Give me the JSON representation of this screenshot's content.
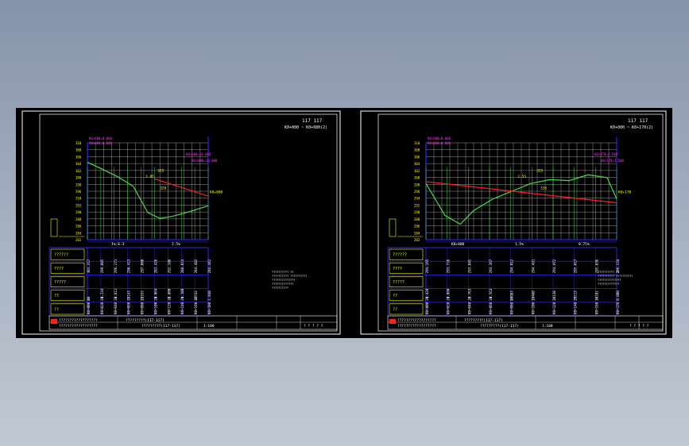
{
  "colors": {
    "background": "#000000",
    "frame": "#ffffff",
    "grid": "#d8d8d8",
    "axis": "#3030ff",
    "ground_line": "#44dd44",
    "design_line": "#ff2020",
    "label": "#ffff00",
    "note": "#ff33ff",
    "table_text": "#ffffff"
  },
  "sheets": [
    {
      "id": "left",
      "header": {
        "title": "117  117",
        "subtitle": "K0+000 ~ K0+080(2)"
      },
      "row_labels": [
        "??????",
        "????",
        "?????",
        "??",
        "??"
      ],
      "axis_ticks": [
        "310",
        "308",
        "306",
        "304",
        "302",
        "300",
        "298",
        "296",
        "294",
        "292",
        "290",
        "288",
        "286",
        "284",
        "282"
      ],
      "section_marks": [
        "1%:0.3",
        "2.5%"
      ],
      "annotations": {
        "left_top": "K0+000=0.000",
        "right_top": "K0+080=18.000",
        "end_label": "K0+080",
        "mid_labels": [
          "2.85",
          "325",
          "326"
        ]
      },
      "table_cols": [
        [
          "303.317",
          "0",
          "20",
          "K0+000"
        ],
        [
          "299.085",
          "-4.234",
          "20",
          "K0+020"
        ],
        [
          "296.271",
          "-2.811",
          "20",
          "K0+040"
        ],
        [
          "298.413",
          "2.143",
          "20",
          "K0+060"
        ],
        [
          "297.080",
          "1.333",
          "20",
          "K0+080"
        ],
        [
          "283.426",
          "-4.064",
          "20",
          "K0+100"
        ],
        [
          "292.188",
          "-2.800",
          "20",
          "K0+120"
        ],
        [
          "288.014",
          "-0.100",
          "20",
          "K0+140"
        ],
        [
          "284.482",
          "3.532",
          "20",
          "K0+160"
        ],
        [
          "284.482",
          "1.848",
          "",
          "K0+180"
        ]
      ],
      "legend": [
        "?????????? ??",
        "?????????? ??????????",
        "??????????????",
        "?????????????",
        "??????????"
      ],
      "title_block": {
        "company": "??????????????????",
        "drawing": "?????????(117-117)",
        "scale": "1:100",
        "sheet": "? ? ? ? ?"
      }
    },
    {
      "id": "right",
      "header": {
        "title": "117  117",
        "subtitle": "K0+000 ~ K0+170(2)"
      },
      "row_labels": [
        "??????",
        "????",
        "?????",
        "??",
        "??"
      ],
      "axis_ticks": [
        "310",
        "308",
        "306",
        "304",
        "302",
        "300",
        "298",
        "296",
        "294",
        "292",
        "290",
        "288",
        "286",
        "284",
        "282"
      ],
      "section_marks": [
        "K0+000",
        "1.5%",
        "0.75%"
      ],
      "annotations": {
        "left_top": "K0+000=0.000",
        "right_top": "K0+170=3.500",
        "end_label": "K0+170",
        "mid_labels": [
          "2.55",
          "325",
          "326"
        ]
      },
      "table_cols": [
        [
          "294.165",
          "-1.428",
          "20",
          "K0+000"
        ],
        [
          "293.726",
          "-3.080",
          "20",
          "K0+020"
        ],
        [
          "293.045",
          "-3.763",
          "20",
          "K0+040"
        ],
        [
          "293.367",
          "-1.563",
          "20",
          "K0+060"
        ],
        [
          "294.012",
          "0.083",
          "20",
          "K0+080"
        ],
        [
          "294.491",
          "1.480",
          "20",
          "K0+100"
        ],
        [
          "294.972",
          "2.138",
          "20",
          "K0+120"
        ],
        [
          "295.017",
          "2.513",
          "20",
          "K0+140"
        ],
        [
          "295.836",
          "3.102",
          "20",
          "K0+160"
        ],
        [
          "296.134",
          "0.000",
          "",
          "K0+170"
        ]
      ],
      "legend": [
        "?????????? ??",
        "?????????? ??????????",
        "??????????????",
        "?????????????"
      ],
      "title_block": {
        "company": "??????????????????",
        "drawing": "?????????(117-117)",
        "scale": "1:100",
        "sheet": "? ? ? ? ?"
      }
    }
  ]
}
